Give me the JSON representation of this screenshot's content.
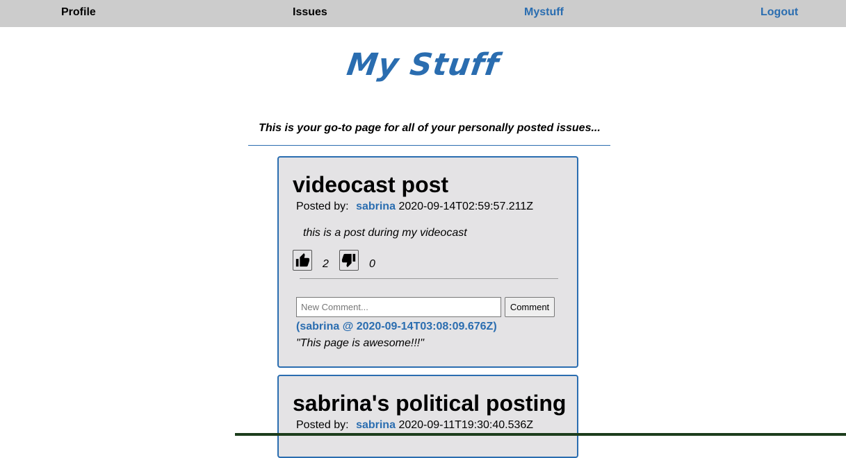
{
  "nav": {
    "profile": "Profile",
    "issues": "Issues",
    "mystuff": "Mystuff",
    "logout": "Logout"
  },
  "page": {
    "title": "My Stuff",
    "subtitle": "This is your go-to page for all of your personally posted issues..."
  },
  "posts": [
    {
      "title": "videocast post",
      "posted_by_label": "Posted by:",
      "author": "sabrina",
      "timestamp": "2020-09-14T02:59:57.211Z",
      "body": "this is a post during my videocast",
      "upvotes": "2",
      "downvotes": "0",
      "comment_placeholder": "New Comment...",
      "comment_button": "Comment",
      "comments": [
        {
          "meta": "(sabrina @ 2020-09-14T03:08:09.676Z)",
          "text": "\"This page is awesome!!!\""
        }
      ]
    },
    {
      "title": "sabrina's political posting",
      "posted_by_label": "Posted by:",
      "author": "sabrina",
      "timestamp": "2020-09-11T19:30:40.536Z"
    }
  ],
  "icons": {
    "upvote": "thumbs-up-icon",
    "downvote": "thumbs-down-icon"
  },
  "colors": {
    "accent": "#2a6db0",
    "navbar": "#cccccc",
    "card_bg": "#e4e3e5"
  }
}
